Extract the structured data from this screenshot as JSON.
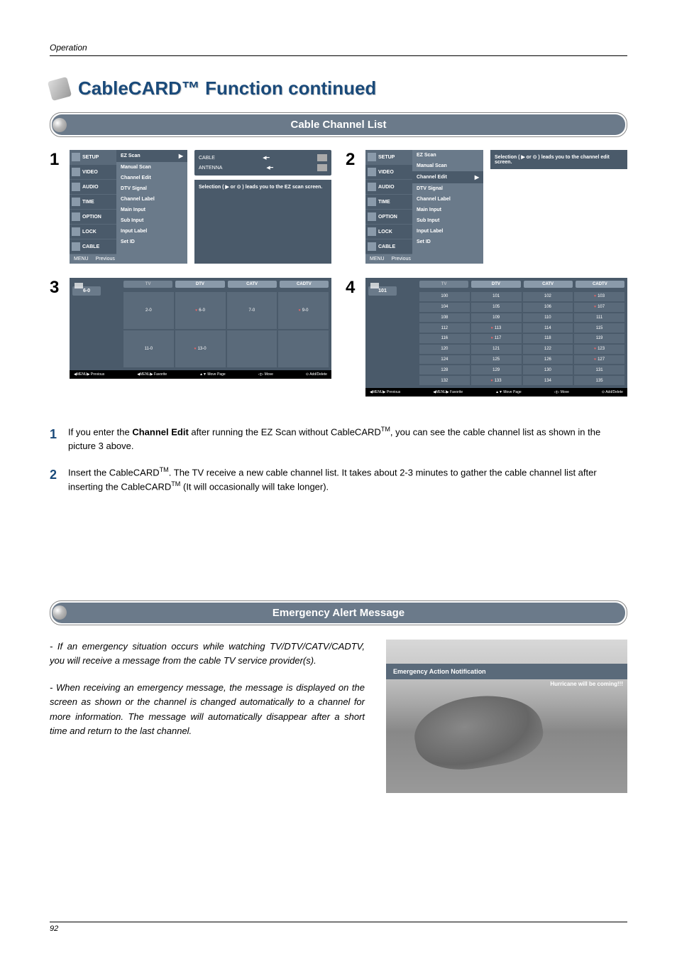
{
  "header": "Operation",
  "pageTitle": "CableCARD™ Function continued",
  "section1": {
    "title": "Cable Channel List"
  },
  "section2": {
    "title": "Emergency Alert Message"
  },
  "sidebar": {
    "items": [
      "SETUP",
      "VIDEO",
      "AUDIO",
      "TIME",
      "OPTION",
      "LOCK",
      "CABLE"
    ]
  },
  "menuList": {
    "items": [
      "EZ Scan",
      "Manual Scan",
      "Channel Edit",
      "DTV Signal",
      "Channel Label",
      "Main Input",
      "Sub Input",
      "Input Label",
      "Set ID"
    ]
  },
  "menuFooter": {
    "menu": "MENU",
    "prev": "Previous"
  },
  "antenna": {
    "cable": "CABLE",
    "antenna": "ANTENNA"
  },
  "hint1": "Selection ( ▶ or ⊙ ) leads you to the EZ scan screen.",
  "hint2": "Selection ( ▶ or ⊙ ) leads you to the channel edit screen.",
  "stepLabels": {
    "s1": "1",
    "s2": "2",
    "s3": "3",
    "s4": "4"
  },
  "channel3": {
    "name": "6-0",
    "tabs": [
      "TV",
      "DTV",
      "CATV",
      "CADTV"
    ],
    "cells": [
      {
        "v": "2-0",
        "f": false
      },
      {
        "v": "6-0",
        "f": true
      },
      {
        "v": "7-0",
        "f": false
      },
      {
        "v": "9-0",
        "f": true
      },
      {
        "v": "11-0",
        "f": false
      },
      {
        "v": "13-0",
        "f": true
      },
      {
        "v": "",
        "f": false
      },
      {
        "v": "",
        "f": false
      }
    ]
  },
  "channel4": {
    "name": "101",
    "tabs": [
      "TV",
      "DTV",
      "CATV",
      "CADTV"
    ],
    "cells": [
      {
        "v": "100",
        "f": false
      },
      {
        "v": "101",
        "f": false
      },
      {
        "v": "102",
        "f": false
      },
      {
        "v": "103",
        "f": true
      },
      {
        "v": "104",
        "f": false
      },
      {
        "v": "105",
        "f": false
      },
      {
        "v": "106",
        "f": false
      },
      {
        "v": "107",
        "f": true
      },
      {
        "v": "108",
        "f": false
      },
      {
        "v": "109",
        "f": false
      },
      {
        "v": "110",
        "f": false
      },
      {
        "v": "111",
        "f": false
      },
      {
        "v": "112",
        "f": false
      },
      {
        "v": "113",
        "f": true
      },
      {
        "v": "114",
        "f": false
      },
      {
        "v": "115",
        "f": false
      },
      {
        "v": "116",
        "f": false
      },
      {
        "v": "117",
        "f": true
      },
      {
        "v": "118",
        "f": false
      },
      {
        "v": "119",
        "f": false
      },
      {
        "v": "120",
        "f": false
      },
      {
        "v": "121",
        "f": false
      },
      {
        "v": "122",
        "f": false
      },
      {
        "v": "123",
        "f": true
      },
      {
        "v": "124",
        "f": false
      },
      {
        "v": "125",
        "f": false
      },
      {
        "v": "126",
        "f": false
      },
      {
        "v": "127",
        "f": true
      },
      {
        "v": "128",
        "f": false
      },
      {
        "v": "129",
        "f": false
      },
      {
        "v": "130",
        "f": false
      },
      {
        "v": "131",
        "f": false
      },
      {
        "v": "132",
        "f": false
      },
      {
        "v": "133",
        "f": true
      },
      {
        "v": "134",
        "f": false
      },
      {
        "v": "135",
        "f": false
      }
    ]
  },
  "chFooter": {
    "prev": "◀MENU▶ Previous",
    "fav": "◀MENU▶ Favorite",
    "page": "▲▼ Move Page",
    "move": "◁▷ Move",
    "add": "⊙ Add/Delete"
  },
  "paragraphs": {
    "p1num": "1",
    "p1a": "If you enter the ",
    "p1b": "Channel Edit",
    "p1c": " after running the EZ Scan without CableCARD",
    "p1d": ", you can see the cable channel list as shown in the picture 3 above.",
    "p2num": "2",
    "p2a": "Insert the CableCARD",
    "p2b": ". The TV receive a new cable channel list. It takes about 2-3 minutes to gather the cable channel list after inserting the CableCARD",
    "p2c": " (It will occasionally will take longer)."
  },
  "emergency": {
    "p1": "- If an emergency situation occurs while watching TV/DTV/CATV/CADTV, you will receive a message from the cable TV service provider(s).",
    "p2": "- When receiving an emergency message, the message is displayed on the screen as shown or the channel is changed automatically to a channel for more information. The message will automatically disappear after a short time and return to the last channel.",
    "banner": "Emergency Action Notification",
    "scroll": "Hurricane will be coming!!!"
  },
  "tm": "TM",
  "pageNum": "92"
}
